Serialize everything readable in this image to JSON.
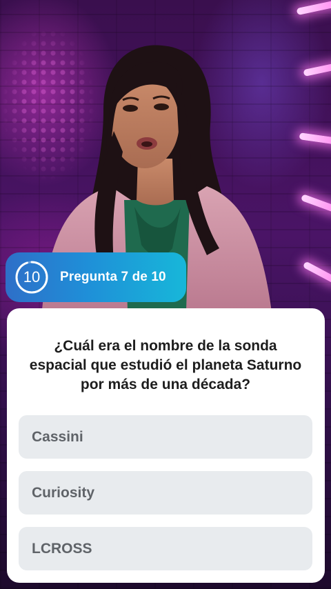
{
  "timer": {
    "value": "10",
    "progress": 0.95
  },
  "header": {
    "question_counter": "Pregunta 7 de 10"
  },
  "question": {
    "text": "¿Cuál era el nombre de la sonda espacial que estudió el planeta Saturno por más de una década?"
  },
  "options": [
    {
      "label": "Cassini"
    },
    {
      "label": "Curiosity"
    },
    {
      "label": "LCROSS"
    }
  ],
  "colors": {
    "pill_start": "#2e6fc8",
    "pill_end": "#17b7d9",
    "card_bg": "#ffffff",
    "option_bg": "#e8ebee",
    "option_text": "#5f6368",
    "question_text": "#1d1d1d"
  }
}
